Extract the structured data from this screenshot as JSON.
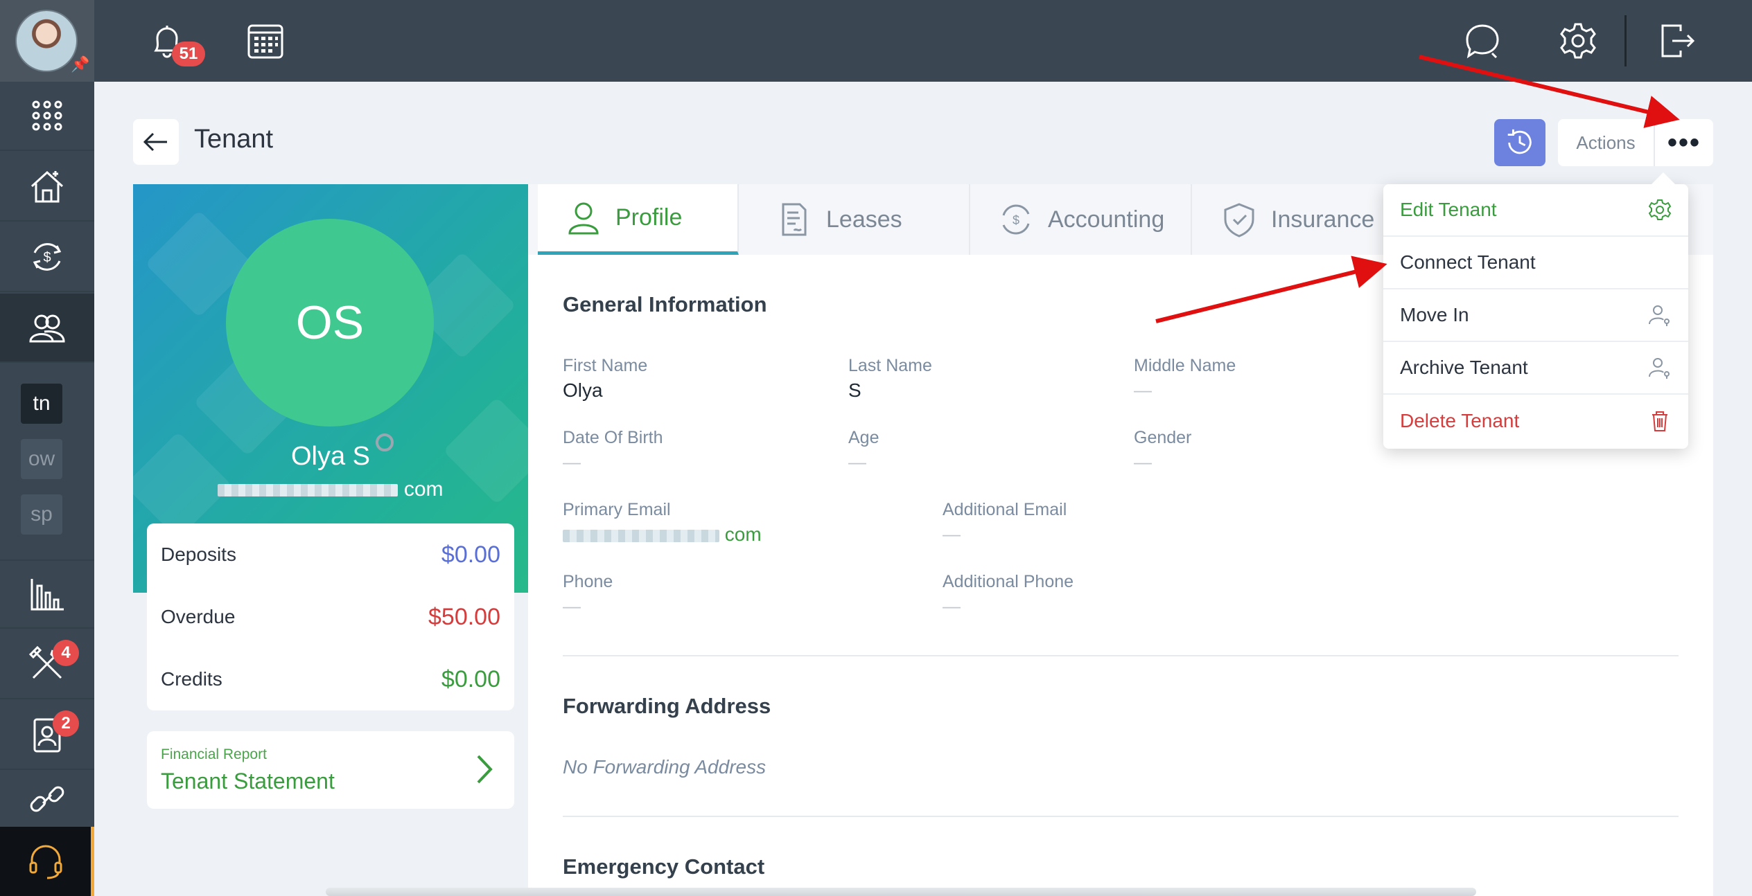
{
  "topbar": {
    "notifications_count": "51",
    "icons": [
      "bell-icon",
      "calendar-icon",
      "chat-icon",
      "gear-icon",
      "logout-icon"
    ]
  },
  "sidebar": {
    "properties": [
      "tn",
      "ow",
      "sp"
    ],
    "maintenance_badge": "4",
    "applicants_badge": "2"
  },
  "header": {
    "title": "Tenant",
    "actions_label": "Actions",
    "more_label": "•••"
  },
  "profile": {
    "initials": "OS",
    "name": "Olya S",
    "email_suffix": "com"
  },
  "balances": [
    {
      "label": "Deposits",
      "value": "$0.00",
      "color": "#5a6fd6"
    },
    {
      "label": "Overdue",
      "value": "$50.00",
      "color": "#d63c3c"
    },
    {
      "label": "Credits",
      "value": "$0.00",
      "color": "#3a9c3e"
    }
  ],
  "report": {
    "subtitle": "Financial Report",
    "title": "Tenant Statement"
  },
  "tabs": [
    {
      "label": "Profile",
      "icon": "person-icon"
    },
    {
      "label": "Leases",
      "icon": "document-icon"
    },
    {
      "label": "Accounting",
      "icon": "dollar-cycle-icon"
    },
    {
      "label": "Insurance",
      "icon": "shield-icon"
    }
  ],
  "general": {
    "title": "General Information",
    "first_name_label": "First Name",
    "first_name": "Olya",
    "last_name_label": "Last Name",
    "last_name": "S",
    "middle_name_label": "Middle Name",
    "middle_name": "—",
    "dob_label": "Date Of Birth",
    "dob": "—",
    "age_label": "Age",
    "age": "—",
    "gender_label": "Gender",
    "gender": "—",
    "primary_email_label": "Primary Email",
    "primary_email_suffix": "com",
    "additional_email_label": "Additional Email",
    "additional_email": "—",
    "phone_label": "Phone",
    "phone": "—",
    "additional_phone_label": "Additional Phone",
    "additional_phone": "—"
  },
  "forwarding": {
    "title": "Forwarding Address",
    "empty": "No Forwarding Address"
  },
  "emergency": {
    "title": "Emergency Contact"
  },
  "dropdown": {
    "items": [
      {
        "label": "Edit Tenant",
        "color": "#3a9c3e",
        "icon": "gear-icon"
      },
      {
        "label": "Connect Tenant",
        "color": "#2c3440",
        "icon": ""
      },
      {
        "label": "Move In",
        "color": "#2c3440",
        "icon": "user-key-icon"
      },
      {
        "label": "Archive Tenant",
        "color": "#2c3440",
        "icon": "user-key-icon"
      },
      {
        "label": "Delete Tenant",
        "color": "#d63c3c",
        "icon": "trash-icon"
      }
    ]
  },
  "colors": {
    "accent_green": "#3a9c3e",
    "accent_blue": "#6d82de",
    "danger": "#d63c3c",
    "annotation_red": "#e01010"
  }
}
